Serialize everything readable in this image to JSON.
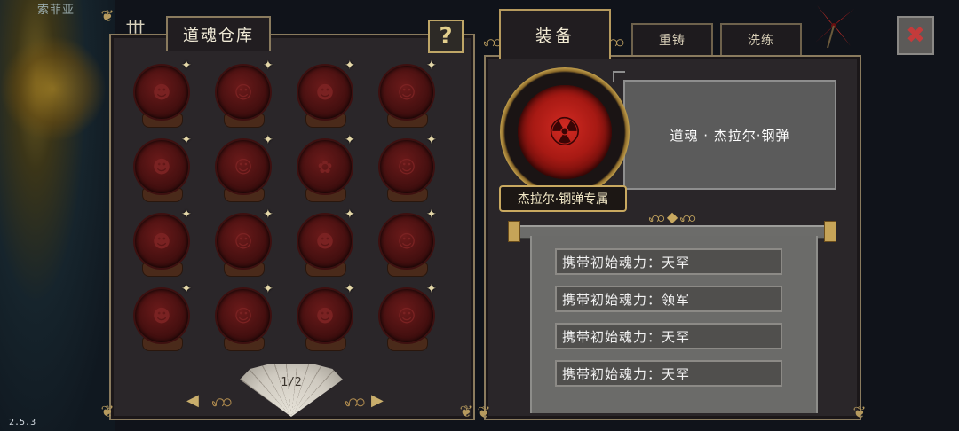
{
  "background": {
    "name_partial": "索菲亚",
    "top_label": ""
  },
  "version": "2.5.3",
  "left_panel": {
    "title": "道魂仓库",
    "help_label": "?",
    "pager": {
      "label": "1/2",
      "prev": "◀",
      "next": "▶"
    },
    "slot_count": 16
  },
  "right_panel": {
    "tabs": [
      {
        "label": "装备",
        "active": true
      },
      {
        "label": "重铸",
        "active": false
      },
      {
        "label": "洗练",
        "active": false
      }
    ],
    "close_label": "✖",
    "selected": {
      "name": "道魂 · 杰拉尔·钢弹",
      "exclusive": "杰拉尔·钢弹专属"
    },
    "stats": [
      "携带初始魂力：天罕",
      "携带初始魂力：领军",
      "携带初始魂力：天罕",
      "携带初始魂力：天罕"
    ]
  },
  "colors": {
    "frame_gold": "#b69a5e",
    "orb_red": "#d22a22",
    "panel_bg": "#2a2629"
  }
}
